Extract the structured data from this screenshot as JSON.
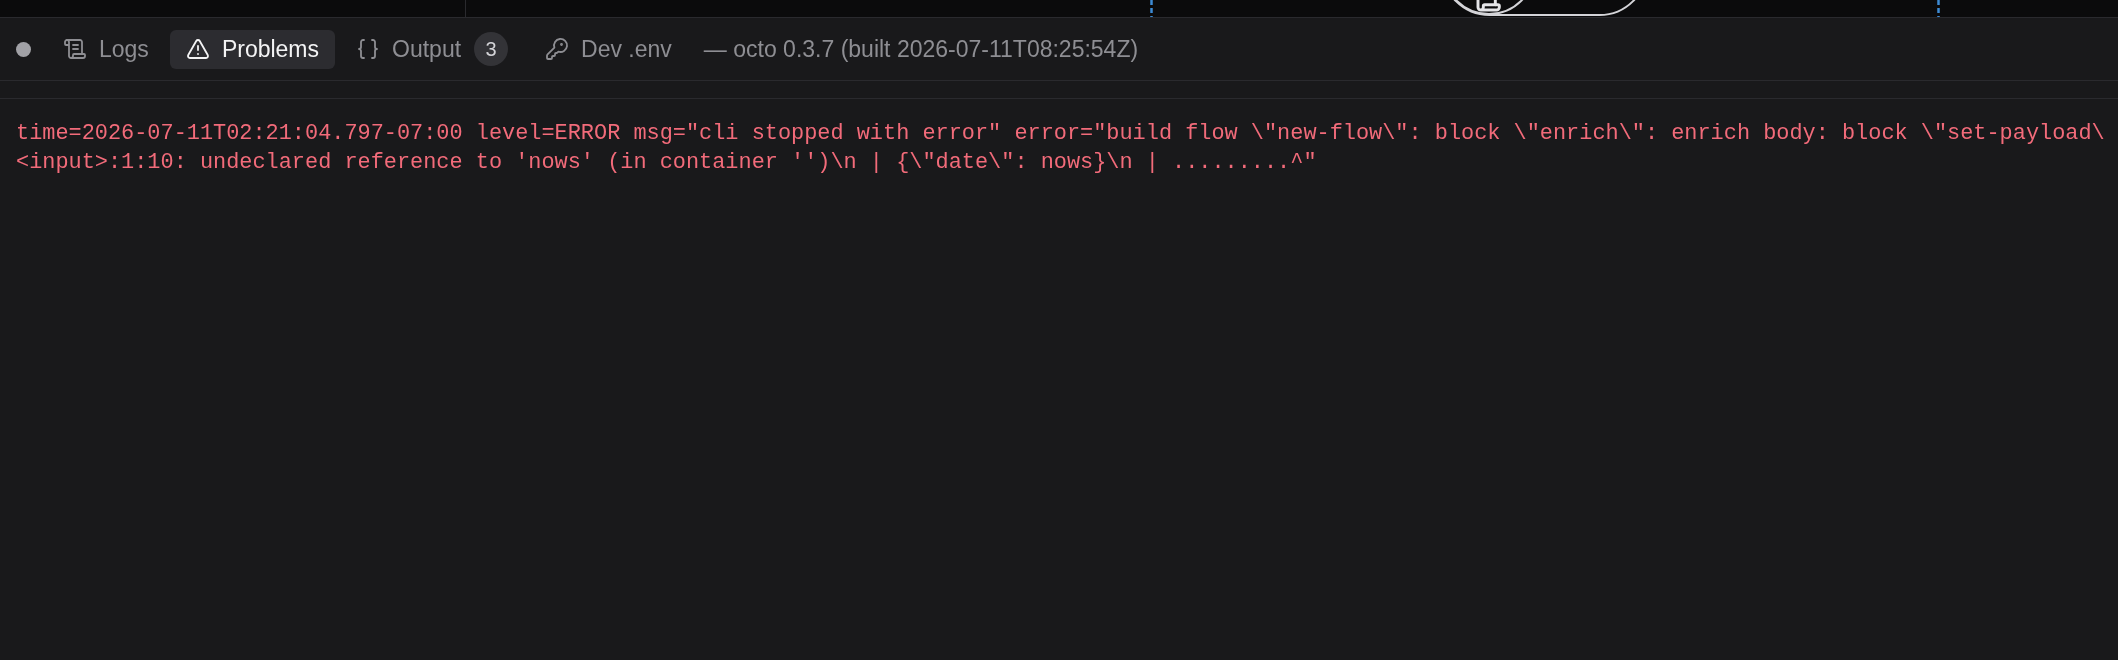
{
  "panel": {
    "tabs": [
      {
        "label": "Logs",
        "selected": false
      },
      {
        "label": "Problems",
        "selected": true
      },
      {
        "label": "Output",
        "badge": "3",
        "selected": false
      },
      {
        "label": "Dev .env",
        "selected": false
      }
    ],
    "build_info": "— octo 0.3.7 (built 2026-07-11T08:25:54Z)"
  },
  "log_output": {
    "lines": [
      "time=2026-07-11T02:21:04.797-07:00 level=ERROR msg=\"cli stopped with error\" error=\"build flow \\\"new-flow\\\": block \\\"enrich\\\": enrich body: block \\\"set-payload\\",
      "<input>:1:10: undeclared reference to 'nows' (in container '')\\n | {\\\"date\\\": nows}\\n | .........^\""
    ]
  }
}
